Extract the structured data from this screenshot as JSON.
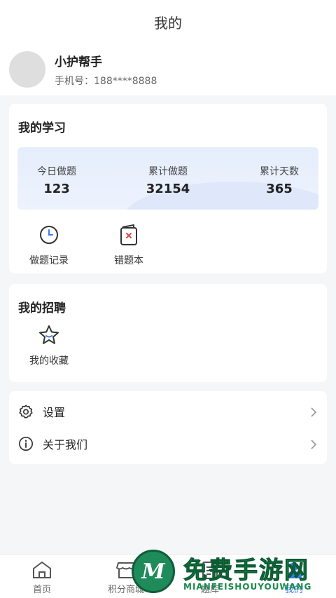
{
  "header": {
    "title": "我的"
  },
  "profile": {
    "name": "小护帮手",
    "phone": "手机号：188****8888"
  },
  "study": {
    "title": "我的学习",
    "stats": [
      {
        "label": "今日做题",
        "value": "123"
      },
      {
        "label": "累计做题",
        "value": "32154"
      },
      {
        "label": "累计天数",
        "value": "365"
      }
    ],
    "tools": [
      {
        "label": "做题记录",
        "icon": "clock-icon"
      },
      {
        "label": "错题本",
        "icon": "wrong-book-icon"
      }
    ]
  },
  "recruit": {
    "title": "我的招聘",
    "tools": [
      {
        "label": "我的收藏",
        "icon": "star-icon"
      }
    ]
  },
  "menu": [
    {
      "label": "设置",
      "icon": "gear-icon"
    },
    {
      "label": "关于我们",
      "icon": "info-icon"
    }
  ],
  "tabs": [
    {
      "label": "首页",
      "icon": "home-icon"
    },
    {
      "label": "积分商城",
      "icon": "store-icon"
    },
    {
      "label": "题库",
      "icon": "question-bank-icon"
    },
    {
      "label": "我的",
      "icon": "user-icon",
      "active": true
    }
  ],
  "watermark": {
    "title": "免费手游网",
    "subtitle": "MIANFEISHOUYOUWANG",
    "logo_letter": "M"
  },
  "colors": {
    "accent": "#3a7af0",
    "background": "#f5f6f8",
    "card": "#ffffff",
    "stats_bg": "#e6eefc"
  }
}
